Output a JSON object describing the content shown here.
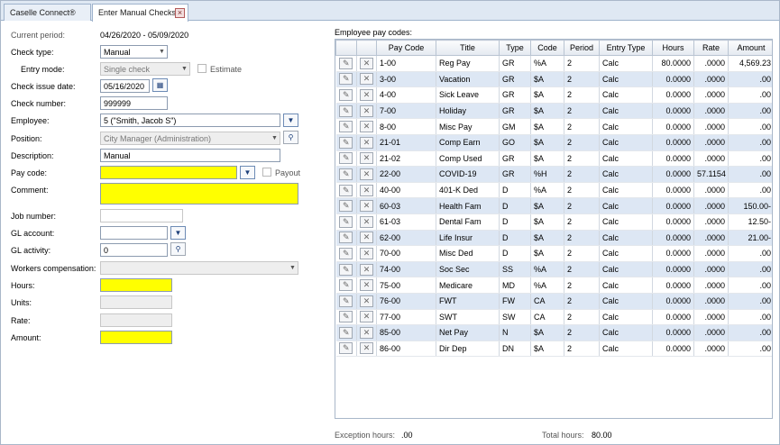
{
  "tabs": [
    {
      "label": "Caselle Connect®"
    },
    {
      "label": "Enter Manual Checks"
    }
  ],
  "form": {
    "current_period_label": "Current period:",
    "current_period_value": "04/26/2020 - 05/09/2020",
    "check_type_label": "Check type:",
    "check_type_value": "Manual",
    "entry_mode_label": "Entry mode:",
    "entry_mode_value": "Single check",
    "estimate_label": "Estimate",
    "check_issue_date_label": "Check issue date:",
    "check_issue_date_value": "05/16/2020",
    "check_number_label": "Check number:",
    "check_number_value": "999999",
    "employee_label": "Employee:",
    "employee_value": "5 (\"Smith, Jacob S\")",
    "position_label": "Position:",
    "position_value": "City Manager (Administration)",
    "description_label": "Description:",
    "description_value": "Manual",
    "pay_code_label": "Pay code:",
    "payout_label": "Payout",
    "comment_label": "Comment:",
    "job_number_label": "Job number:",
    "gl_account_label": "GL account:",
    "gl_activity_label": "GL activity:",
    "gl_activity_value": "0",
    "workers_comp_label": "Workers compensation:",
    "hours_label": "Hours:",
    "units_label": "Units:",
    "rate_label": "Rate:",
    "amount_label": "Amount:"
  },
  "grid": {
    "title": "Employee pay codes:",
    "columns": [
      "Pay Code",
      "Title",
      "Type",
      "Code",
      "Period",
      "Entry Type",
      "Hours",
      "Rate",
      "Amount"
    ],
    "rows": [
      [
        "1-00",
        "Reg Pay",
        "GR",
        "%A",
        "2",
        "Calc",
        "80.0000",
        ".0000",
        "4,569.23"
      ],
      [
        "3-00",
        "Vacation",
        "GR",
        "$A",
        "2",
        "Calc",
        "0.0000",
        ".0000",
        ".00"
      ],
      [
        "4-00",
        "Sick Leave",
        "GR",
        "$A",
        "2",
        "Calc",
        "0.0000",
        ".0000",
        ".00"
      ],
      [
        "7-00",
        "Holiday",
        "GR",
        "$A",
        "2",
        "Calc",
        "0.0000",
        ".0000",
        ".00"
      ],
      [
        "8-00",
        "Misc Pay",
        "GM",
        "$A",
        "2",
        "Calc",
        "0.0000",
        ".0000",
        ".00"
      ],
      [
        "21-01",
        "Comp Earn",
        "GO",
        "$A",
        "2",
        "Calc",
        "0.0000",
        ".0000",
        ".00"
      ],
      [
        "21-02",
        "Comp Used",
        "GR",
        "$A",
        "2",
        "Calc",
        "0.0000",
        ".0000",
        ".00"
      ],
      [
        "22-00",
        "COVID-19",
        "GR",
        "%H",
        "2",
        "Calc",
        "0.0000",
        "57.1154",
        ".00"
      ],
      [
        "40-00",
        "401-K Ded",
        "D",
        "%A",
        "2",
        "Calc",
        "0.0000",
        ".0000",
        ".00"
      ],
      [
        "60-03",
        "Health Fam",
        "D",
        "$A",
        "2",
        "Calc",
        "0.0000",
        ".0000",
        "150.00-"
      ],
      [
        "61-03",
        "Dental Fam",
        "D",
        "$A",
        "2",
        "Calc",
        "0.0000",
        ".0000",
        "12.50-"
      ],
      [
        "62-00",
        "Life Insur",
        "D",
        "$A",
        "2",
        "Calc",
        "0.0000",
        ".0000",
        "21.00-"
      ],
      [
        "70-00",
        "Misc Ded",
        "D",
        "$A",
        "2",
        "Calc",
        "0.0000",
        ".0000",
        ".00"
      ],
      [
        "74-00",
        "Soc Sec",
        "SS",
        "%A",
        "2",
        "Calc",
        "0.0000",
        ".0000",
        ".00"
      ],
      [
        "75-00",
        "Medicare",
        "MD",
        "%A",
        "2",
        "Calc",
        "0.0000",
        ".0000",
        ".00"
      ],
      [
        "76-00",
        "FWT",
        "FW",
        "CA",
        "2",
        "Calc",
        "0.0000",
        ".0000",
        ".00"
      ],
      [
        "77-00",
        "SWT",
        "SW",
        "CA",
        "2",
        "Calc",
        "0.0000",
        ".0000",
        ".00"
      ],
      [
        "85-00",
        "Net Pay",
        "N",
        "$A",
        "2",
        "Calc",
        "0.0000",
        ".0000",
        ".00"
      ],
      [
        "86-00",
        "Dir Dep",
        "DN",
        "$A",
        "2",
        "Calc",
        "0.0000",
        ".0000",
        ".00"
      ]
    ]
  },
  "footer": {
    "exception_hours_label": "Exception hours:",
    "exception_hours_value": ".00",
    "total_hours_label": "Total hours:",
    "total_hours_value": "80.00"
  }
}
